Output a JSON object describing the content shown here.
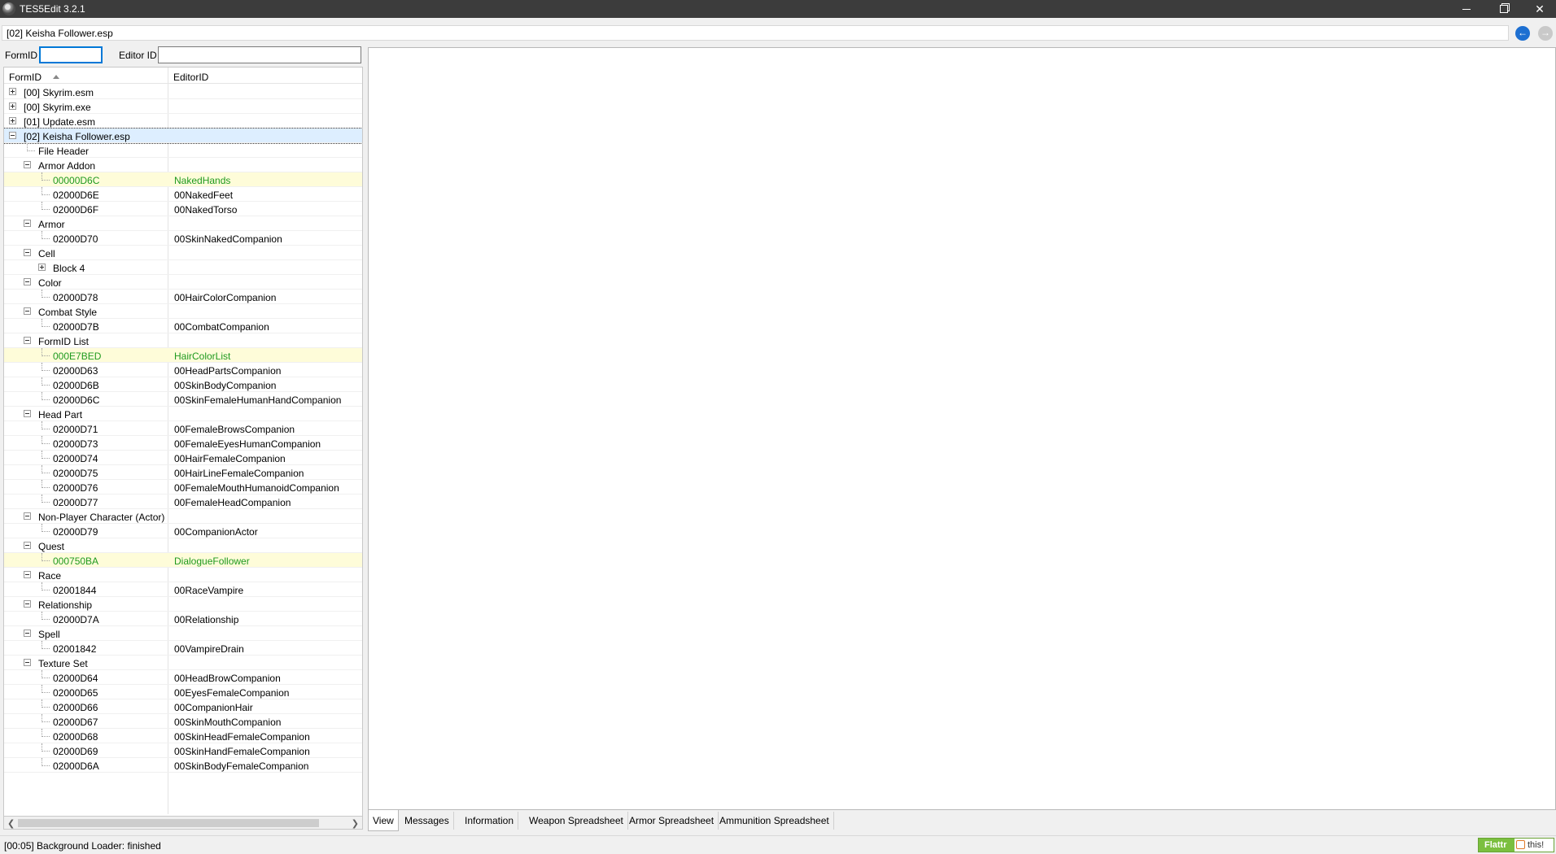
{
  "window": {
    "title": "TES5Edit 3.2.1"
  },
  "path": "[02] Keisha Follower.esp",
  "filters": {
    "formid_label": "FormID",
    "editorid_label": "Editor ID",
    "formid_value": "",
    "editorid_value": ""
  },
  "tree": {
    "columns": [
      "FormID",
      "EditorID"
    ],
    "rows": [
      {
        "level": 0,
        "expander": "plus",
        "formid": "[00] Skyrim.esm",
        "editorid": ""
      },
      {
        "level": 0,
        "expander": "plus",
        "formid": "[00] Skyrim.exe",
        "editorid": ""
      },
      {
        "level": 0,
        "expander": "plus",
        "formid": "[01] Update.esm",
        "editorid": ""
      },
      {
        "level": 0,
        "expander": "minus",
        "formid": "[02] Keisha Follower.esp",
        "editorid": "",
        "selected": true
      },
      {
        "level": 1,
        "expander": "none",
        "formid": "File Header",
        "editorid": ""
      },
      {
        "level": 1,
        "expander": "minus",
        "formid": "Armor Addon",
        "editorid": ""
      },
      {
        "level": 2,
        "expander": "none",
        "formid": "00000D6C",
        "editorid": "NakedHands",
        "highlight": true
      },
      {
        "level": 2,
        "expander": "none",
        "formid": "02000D6E",
        "editorid": "00NakedFeet"
      },
      {
        "level": 2,
        "expander": "none",
        "formid": "02000D6F",
        "editorid": "00NakedTorso"
      },
      {
        "level": 1,
        "expander": "minus",
        "formid": "Armor",
        "editorid": ""
      },
      {
        "level": 2,
        "expander": "none",
        "formid": "02000D70",
        "editorid": "00SkinNakedCompanion"
      },
      {
        "level": 1,
        "expander": "minus",
        "formid": "Cell",
        "editorid": ""
      },
      {
        "level": 2,
        "expander": "plus",
        "formid": "Block 4",
        "editorid": ""
      },
      {
        "level": 1,
        "expander": "minus",
        "formid": "Color",
        "editorid": ""
      },
      {
        "level": 2,
        "expander": "none",
        "formid": "02000D78",
        "editorid": "00HairColorCompanion"
      },
      {
        "level": 1,
        "expander": "minus",
        "formid": "Combat Style",
        "editorid": ""
      },
      {
        "level": 2,
        "expander": "none",
        "formid": "02000D7B",
        "editorid": "00CombatCompanion"
      },
      {
        "level": 1,
        "expander": "minus",
        "formid": "FormID List",
        "editorid": ""
      },
      {
        "level": 2,
        "expander": "none",
        "formid": "000E7BED",
        "editorid": "HairColorList",
        "highlight": true
      },
      {
        "level": 2,
        "expander": "none",
        "formid": "02000D63",
        "editorid": "00HeadPartsCompanion"
      },
      {
        "level": 2,
        "expander": "none",
        "formid": "02000D6B",
        "editorid": "00SkinBodyCompanion"
      },
      {
        "level": 2,
        "expander": "none",
        "formid": "02000D6C",
        "editorid": "00SkinFemaleHumanHandCompanion"
      },
      {
        "level": 1,
        "expander": "minus",
        "formid": "Head Part",
        "editorid": ""
      },
      {
        "level": 2,
        "expander": "none",
        "formid": "02000D71",
        "editorid": "00FemaleBrowsCompanion"
      },
      {
        "level": 2,
        "expander": "none",
        "formid": "02000D73",
        "editorid": "00FemaleEyesHumanCompanion"
      },
      {
        "level": 2,
        "expander": "none",
        "formid": "02000D74",
        "editorid": "00HairFemaleCompanion"
      },
      {
        "level": 2,
        "expander": "none",
        "formid": "02000D75",
        "editorid": "00HairLineFemaleCompanion"
      },
      {
        "level": 2,
        "expander": "none",
        "formid": "02000D76",
        "editorid": "00FemaleMouthHumanoidCompanion"
      },
      {
        "level": 2,
        "expander": "none",
        "formid": "02000D77",
        "editorid": "00FemaleHeadCompanion"
      },
      {
        "level": 1,
        "expander": "minus",
        "formid": "Non-Player Character (Actor)",
        "editorid": ""
      },
      {
        "level": 2,
        "expander": "none",
        "formid": "02000D79",
        "editorid": "00CompanionActor"
      },
      {
        "level": 1,
        "expander": "minus",
        "formid": "Quest",
        "editorid": ""
      },
      {
        "level": 2,
        "expander": "none",
        "formid": "000750BA",
        "editorid": "DialogueFollower",
        "highlight": true
      },
      {
        "level": 1,
        "expander": "minus",
        "formid": "Race",
        "editorid": ""
      },
      {
        "level": 2,
        "expander": "none",
        "formid": "02001844",
        "editorid": "00RaceVampire"
      },
      {
        "level": 1,
        "expander": "minus",
        "formid": "Relationship",
        "editorid": ""
      },
      {
        "level": 2,
        "expander": "none",
        "formid": "02000D7A",
        "editorid": "00Relationship"
      },
      {
        "level": 1,
        "expander": "minus",
        "formid": "Spell",
        "editorid": ""
      },
      {
        "level": 2,
        "expander": "none",
        "formid": "02001842",
        "editorid": "00VampireDrain"
      },
      {
        "level": 1,
        "expander": "minus",
        "formid": "Texture Set",
        "editorid": ""
      },
      {
        "level": 2,
        "expander": "none",
        "formid": "02000D64",
        "editorid": "00HeadBrowCompanion"
      },
      {
        "level": 2,
        "expander": "none",
        "formid": "02000D65",
        "editorid": "00EyesFemaleCompanion"
      },
      {
        "level": 2,
        "expander": "none",
        "formid": "02000D66",
        "editorid": "00CompanionHair"
      },
      {
        "level": 2,
        "expander": "none",
        "formid": "02000D67",
        "editorid": "00SkinMouthCompanion"
      },
      {
        "level": 2,
        "expander": "none",
        "formid": "02000D68",
        "editorid": "00SkinHeadFemaleCompanion"
      },
      {
        "level": 2,
        "expander": "none",
        "formid": "02000D69",
        "editorid": "00SkinHandFemaleCompanion"
      },
      {
        "level": 2,
        "expander": "none",
        "formid": "02000D6A",
        "editorid": "00SkinBodyFemaleCompanion"
      }
    ]
  },
  "tabs": [
    "View",
    "Messages",
    "Information",
    "Weapon Spreadsheet",
    "Armor Spreadsheet",
    "Ammunition Spreadsheet"
  ],
  "active_tab": "View",
  "status": "[00:05] Background Loader: finished",
  "flattr": {
    "label": "Flattr",
    "text": "this!"
  },
  "colors": {
    "injected_record": "#1f9a1f",
    "highlight_row": "#fefcd9",
    "selected_row": "#ddeeff"
  },
  "icons": {
    "app": "tes5edit-app-icon",
    "back": "back-arrow-icon",
    "forward": "forward-arrow-icon"
  }
}
